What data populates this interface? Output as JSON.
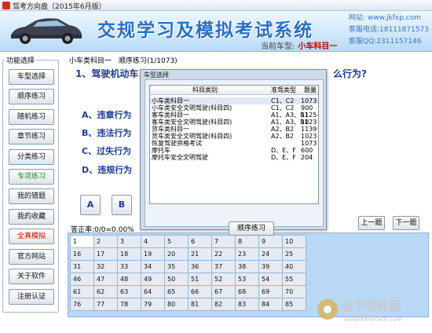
{
  "window": {
    "title": "驾考方向盘（2015年6月版）"
  },
  "banner": {
    "title": "交规学习及模拟考试系统",
    "current_car_label": "当前车型:",
    "current_car_value": "小车科目一",
    "contact": {
      "website": "网站: www.jkfxp.com",
      "phone": "客服电话:18111871573",
      "qq": "客服QQ:2311157146"
    }
  },
  "sidebar": {
    "legend": "功能选择",
    "items": [
      {
        "label": "车型选择",
        "color": "#111111"
      },
      {
        "label": "顺序练习",
        "color": "#111111"
      },
      {
        "label": "随机练习",
        "color": "#111111"
      },
      {
        "label": "章节练习",
        "color": "#111111"
      },
      {
        "label": "分类练习",
        "color": "#111111"
      },
      {
        "label": "专项练习",
        "color": "#1b8d1b"
      },
      {
        "label": "我的错题",
        "color": "#111111"
      },
      {
        "label": "我的收藏",
        "color": "#111111"
      },
      {
        "label": "全真模拟",
        "color": "#d60000"
      },
      {
        "label": "官方网站",
        "color": "#111111"
      },
      {
        "label": "关于软件",
        "color": "#111111"
      },
      {
        "label": "注册认证",
        "color": "#111111"
      }
    ]
  },
  "main": {
    "breadcrumb": "小车类科目一　顺序练习(1/1073)",
    "question_start": "1、驾驶机动车",
    "question_end": "么行为?",
    "options": [
      "A、违章行为",
      "B、违法行为",
      "C、过失行为",
      "D、违规行为"
    ],
    "answer_buttons": [
      "A",
      "B"
    ],
    "prev_label": "上一题",
    "next_label": "下一题",
    "accuracy": "答正率:0/0=0.00%"
  },
  "dialog": {
    "title": "车型选择",
    "columns": [
      "科目类别",
      "准驾类型",
      "题量"
    ],
    "rows": [
      {
        "category": "小车类科目一",
        "license": "C1、C2",
        "count": "1073"
      },
      {
        "category": "小车类安全文明驾驶(科目四)",
        "license": "C1、C2",
        "count": "900"
      },
      {
        "category": "客车类科目一",
        "license": "A1、A3、B1",
        "count": "1125"
      },
      {
        "category": "客车类安全文明驾驶(科目四)",
        "license": "A1、A3、B1",
        "count": "1023"
      },
      {
        "category": "货车类科目一",
        "license": "A2、B2",
        "count": "1139"
      },
      {
        "category": "货车类安全文明驾驶(科目四)",
        "license": "A2、B2",
        "count": "1023"
      },
      {
        "category": "恢复驾驶资格考试",
        "license": "",
        "count": "1073"
      },
      {
        "category": "摩托车",
        "license": "D、E、F",
        "count": "600"
      },
      {
        "category": "摩托车安全文明驾驶",
        "license": "D、E、F",
        "count": "204"
      }
    ],
    "button_label": "顺序练习"
  },
  "question_grid": {
    "numbers": [
      "1",
      "2",
      "3",
      "4",
      "5",
      "6",
      "7",
      "8",
      "9",
      "10",
      "16",
      "17",
      "18",
      "19",
      "20",
      "21",
      "22",
      "23",
      "24",
      "25",
      "31",
      "32",
      "33",
      "34",
      "35",
      "36",
      "37",
      "38",
      "39",
      "40",
      "46",
      "47",
      "48",
      "49",
      "50",
      "51",
      "52",
      "53",
      "54",
      "55",
      "61",
      "62",
      "63",
      "64",
      "65",
      "66",
      "67",
      "68",
      "69",
      "70",
      "76",
      "77",
      "78",
      "79",
      "80",
      "81",
      "82",
      "83",
      "84",
      "85"
    ]
  },
  "watermark": {
    "name": "当下软件园",
    "url": "www.downxia.com"
  }
}
